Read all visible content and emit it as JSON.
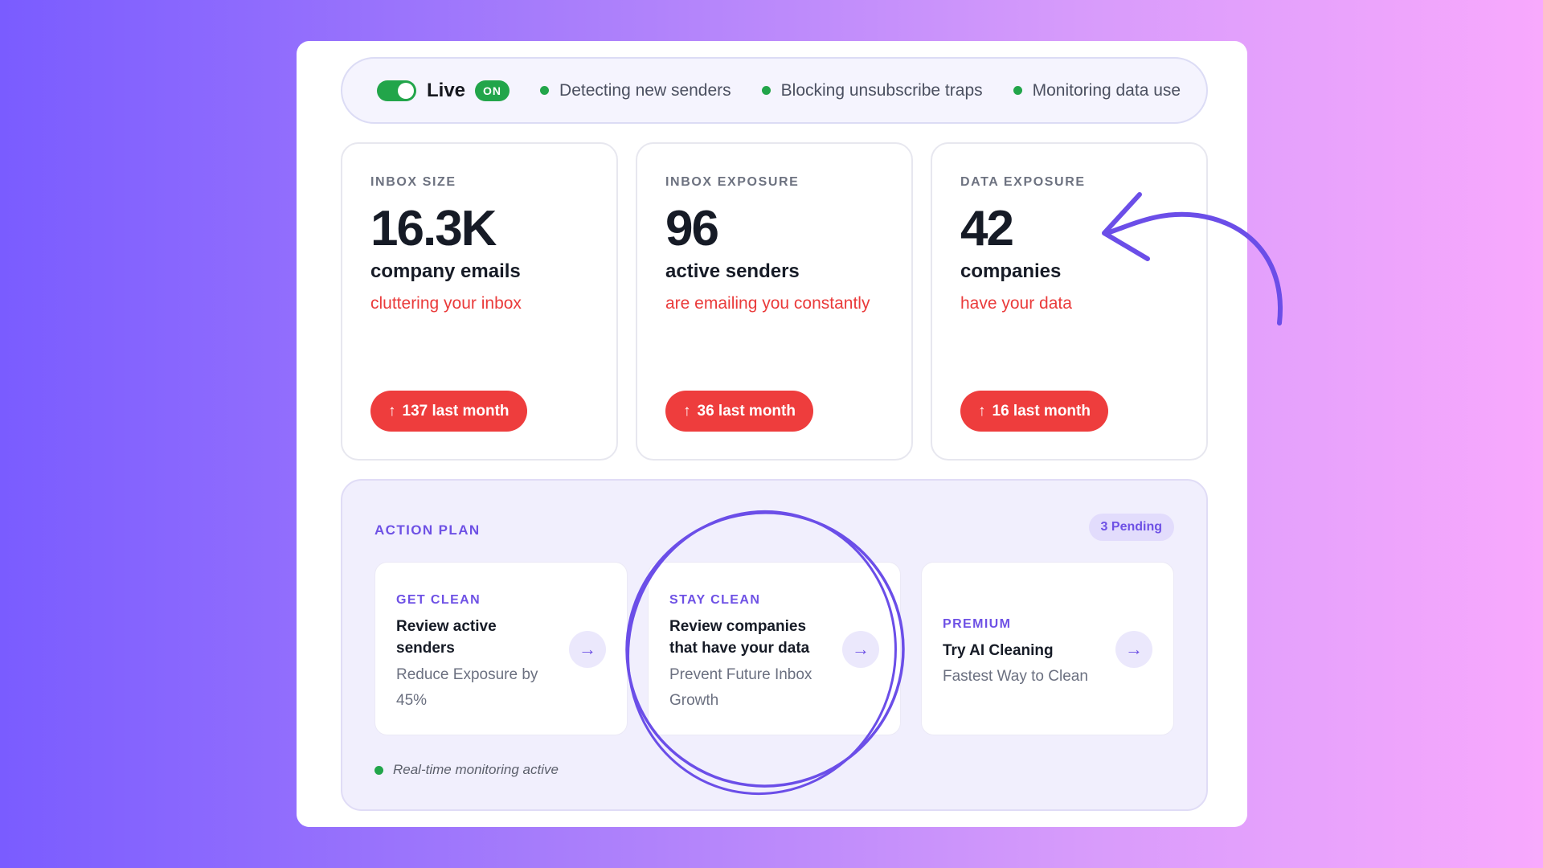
{
  "status_bar": {
    "live_label": "Live",
    "on_badge": "ON",
    "items": [
      "Detecting new senders",
      "Blocking unsubscribe traps",
      "Monitoring data use"
    ]
  },
  "stats": [
    {
      "label": "INBOX SIZE",
      "value": "16.3K",
      "unit": "company emails",
      "desc": "cluttering your inbox",
      "trend": "137 last month"
    },
    {
      "label": "INBOX EXPOSURE",
      "value": "96",
      "unit": "active senders",
      "desc": "are emailing you constantly",
      "trend": "36 last month"
    },
    {
      "label": "DATA EXPOSURE",
      "value": "42",
      "unit": "companies",
      "desc": "have your data",
      "trend": "16 last month"
    }
  ],
  "action_plan": {
    "title": "ACTION PLAN",
    "pending": "3 Pending",
    "cards": [
      {
        "tag": "GET CLEAN",
        "title": "Review active senders",
        "subtitle": "Reduce Exposure by 45%"
      },
      {
        "tag": "STAY CLEAN",
        "title": "Review companies that have your data",
        "subtitle": "Prevent Future Inbox Growth"
      },
      {
        "tag": "PREMIUM",
        "title": "Try AI Cleaning",
        "subtitle": "Fastest Way to Clean"
      }
    ],
    "footer": "Real-time monitoring active"
  },
  "icons": {
    "toggle": "toggle-switch",
    "status_dot": "green-dot",
    "trend": "arrow-up-icon",
    "go": "arrow-right-icon"
  },
  "colors": {
    "accent": "#6e51e5",
    "live_green": "#22a54a",
    "alert_red": "#ee3d3d",
    "annotation_purple": "#6b4ee8"
  }
}
